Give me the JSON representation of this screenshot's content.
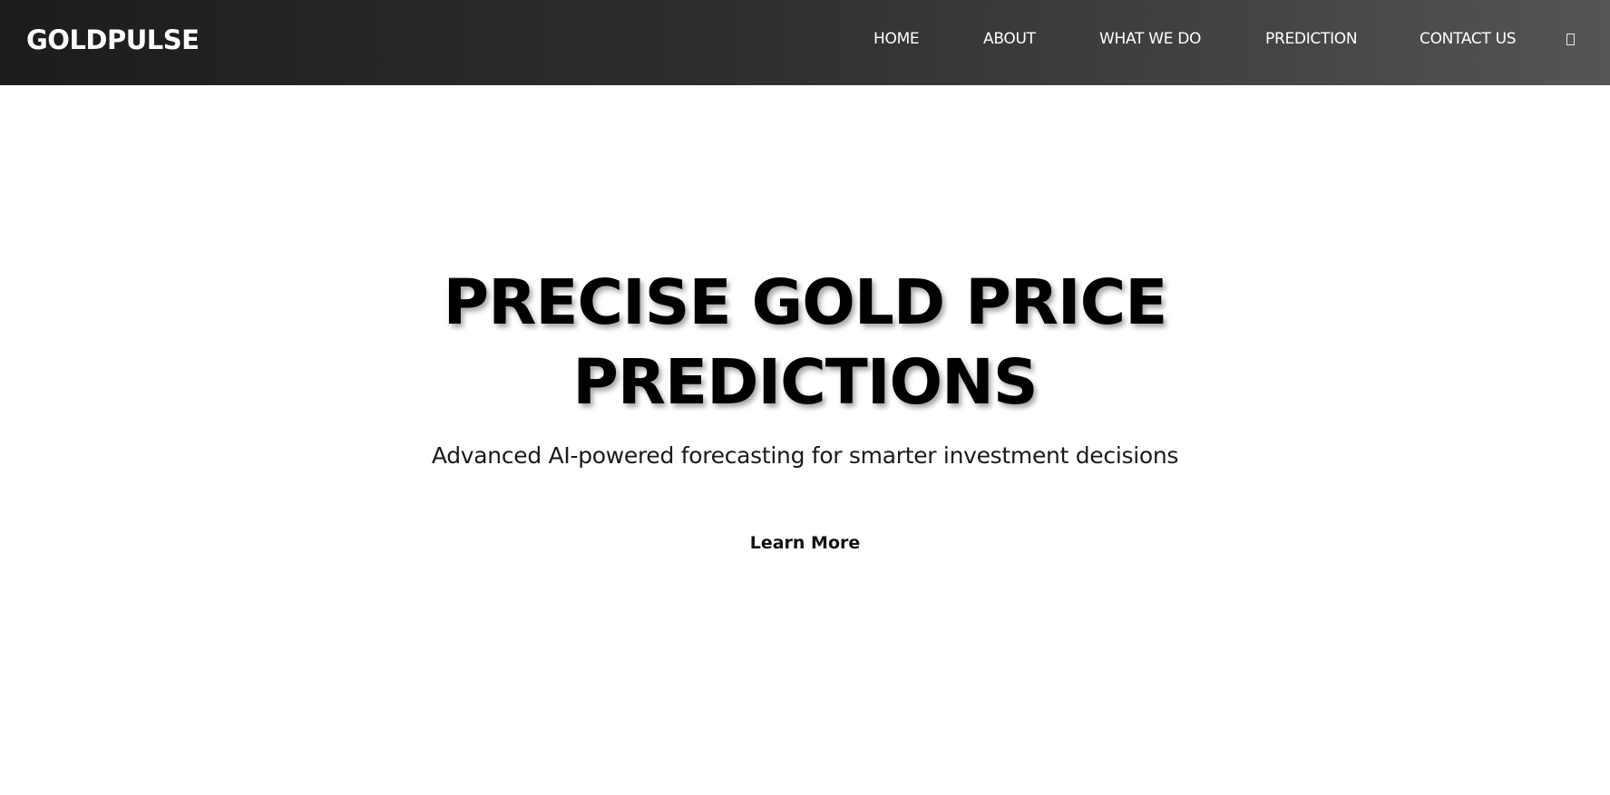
{
  "navbar": {
    "brand": "GOLDPULSE",
    "links": [
      {
        "label": "HOME"
      },
      {
        "label": "ABOUT"
      },
      {
        "label": "WHAT WE DO"
      },
      {
        "label": "PREDICTION"
      },
      {
        "label": "CONTACT US"
      }
    ],
    "menu_icon": "menu-icon"
  },
  "hero": {
    "title_line1": "PRECISE GOLD PRICE",
    "title_line2": "PREDICTIONS",
    "subtitle": "Advanced AI-powered forecasting for smarter investment decisions",
    "cta_label": "Learn More"
  }
}
